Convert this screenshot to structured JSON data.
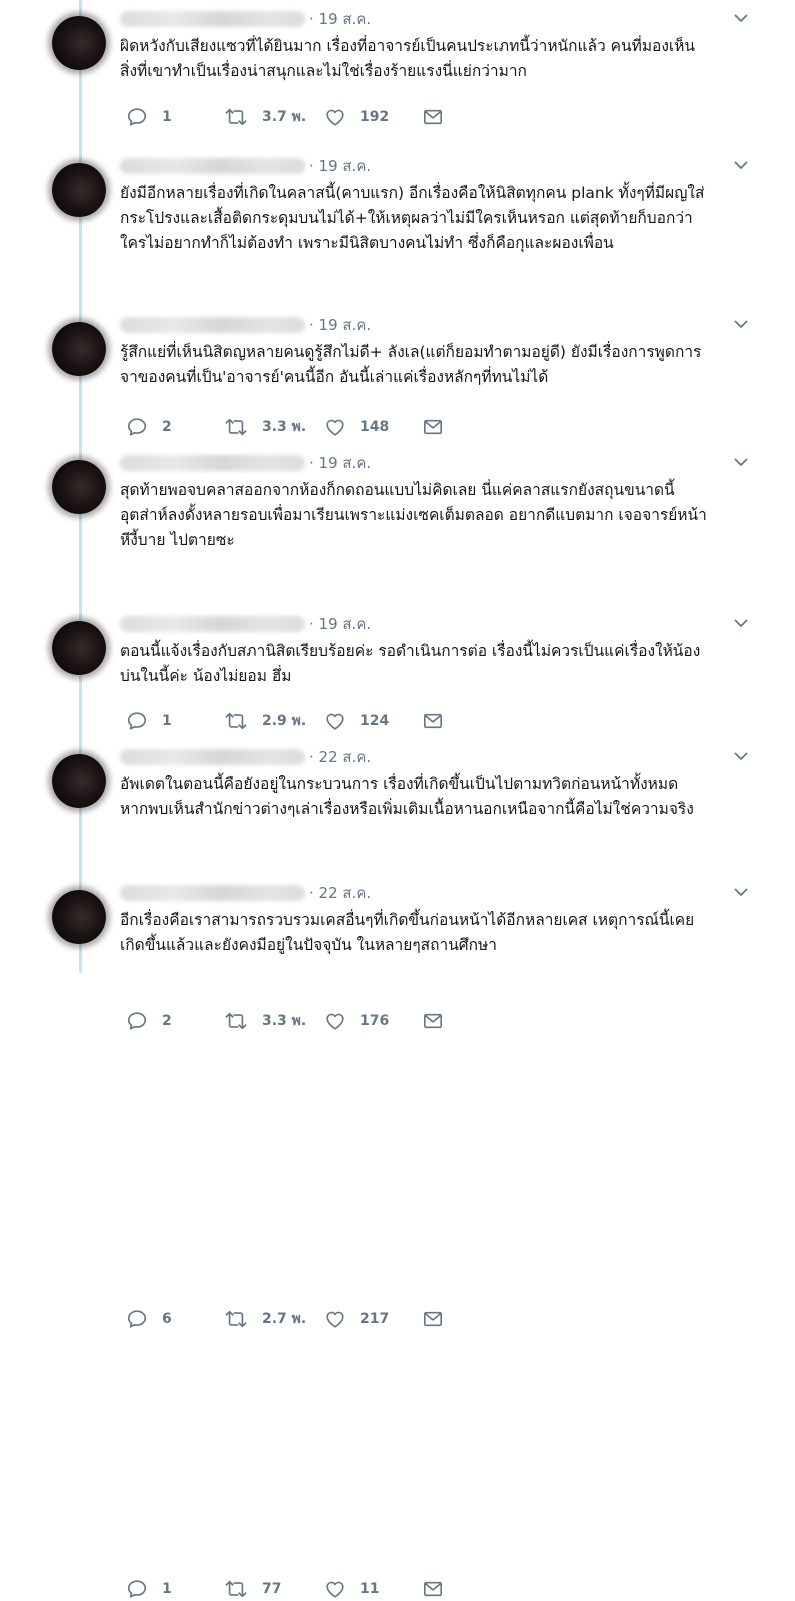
{
  "tweets": [
    {
      "date": "· 19 ส.ค.",
      "lines": [
        "ผิดหวังกับเสียงแซวที่ได้ยินมาก เรื่องที่อาจารย์เป็นคนประเภทนี้ว่าหนักแล้ว คนที่มองเห็น",
        "สิ่งที่เขาทำเป็นเรื่องน่าสนุกและไม่ใช่เรื่องร้ายแรงนี่แย่กว่ามาก"
      ],
      "replies": "1",
      "retweets": "3.7 พ.",
      "likes": "192"
    },
    {
      "date": "· 19 ส.ค.",
      "lines": [
        "ยังมีอีกหลายเรื่องที่เกิดในคลาสนี้(คาบแรก) อีกเรื่องคือให้นิสิตทุกคน plank ทั้งๆที่มีผญใส่",
        "กระโปรงและเสื้อติดกระดุมบนไม่ได้+ให้เหตุผลว่าไม่มีใครเห็นหรอก แต่สุดท้ายก็บอกว่า",
        "ใครไม่อยากทำก็ไม่ต้องทำ เพราะมีนิสิตบางคนไม่ทำ ซึ่งก็คือกุและผองเพื่อน"
      ],
      "replies": "2",
      "retweets": "3.3 พ.",
      "likes": "148"
    },
    {
      "date": "· 19 ส.ค.",
      "lines": [
        "รู้สึกแย่ที่เห็นนิสิตญหลายคนดูรู้สึกไม่ดี+ ลังเล(แต่ก็ยอมทำตามอยู่ดี) ยังมีเรื่องการพูดการ",
        "จาของคนที่เป็น'อาจารย์'คนนี้อีก อันนี้เล่าแค่เรื่องหลักๆที่ทนไม่ได้"
      ],
      "replies": "1",
      "retweets": "2.9 พ.",
      "likes": "124"
    },
    {
      "date": "· 19 ส.ค.",
      "lines": [
        "สุดท้ายพอจบคลาสออกจากห้องก็กดถอนแบบไม่คิดเลย นี่แค่คลาสแรกยังสถุนขนาดนี้",
        "อุตส่าห์ลงดั้งหลายรอบเพื่อมาเรียนเพราะแม่งเซคเต็มตลอด อยากดีแบตมาก เจอจารย์หน้า",
        "หีงี้บาย ไปตายซะ"
      ],
      "replies": "2",
      "retweets": "3.3 พ.",
      "likes": "176"
    },
    {
      "date": "· 19 ส.ค.",
      "lines": [
        "ตอนนี้แจ้งเรื่องกับสภานิสิตเรียบร้อยค่ะ รอดำเนินการต่อ เรื่องนี้ไม่ควรเป็นแค่เรื่องให้น้อง",
        "บ่นในนี้ค่ะ น้องไม่ยอม ฮึ่ม"
      ],
      "replies": "6",
      "retweets": "2.7 พ.",
      "likes": "217"
    },
    {
      "date": "· 22 ส.ค.",
      "lines": [
        "อัพเดตในตอนนี้คือยังอยู่ในกระบวนการ เรื่องที่เกิดขึ้นเป็นไปตามทวิตก่อนหน้าทั้งหมด",
        "หากพบเห็นสำนักข่าวต่างๆเล่าเรื่องหรือเพิ่มเติมเนื้อหานอกเหนือจากนี้คือไม่ใช่ความจริง"
      ],
      "replies": "1",
      "retweets": "77",
      "likes": "11"
    },
    {
      "date": "· 22 ส.ค.",
      "lines": [
        "อีกเรื่องคือเราสามารถรวบรวมเคสอื่นๆที่เกิดขึ้นก่อนหน้าได้อีกหลายเคส เหตุการณ์นี้เคย",
        "เกิดขึ้นแล้วและยังคงมีอยู่ในปัจจุบัน ในหลายๆสถานศึกษา"
      ],
      "replies": "",
      "retweets": "",
      "likes": ""
    }
  ],
  "icons": {
    "reply": "reply-icon",
    "retweet": "retweet-icon",
    "like": "heart-icon",
    "message": "direct-message-icon",
    "more": "chevron-down-icon"
  },
  "colors": {
    "text": "#14171a",
    "muted": "#657786",
    "thread_line": "#c5e4f7"
  }
}
